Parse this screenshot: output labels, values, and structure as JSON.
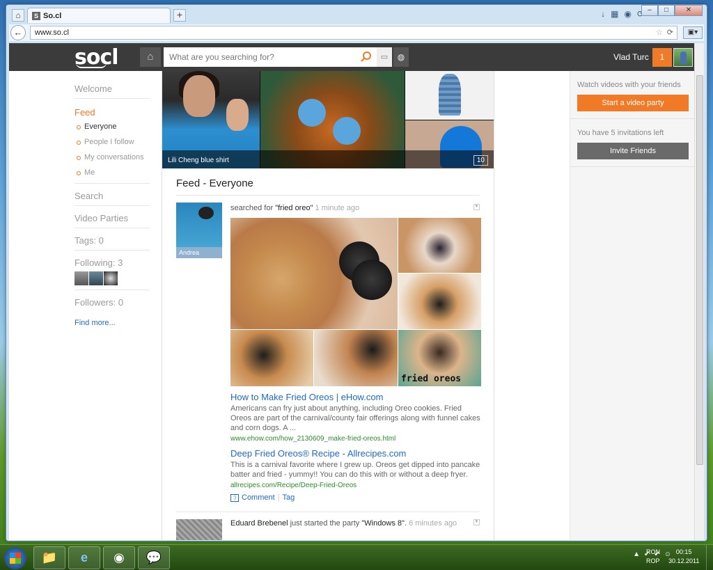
{
  "browser": {
    "tab_title": "So.cl",
    "tab_favicon": "S",
    "url": "www.so.cl",
    "home_tab_icon": "⌂",
    "new_tab_icon": "+",
    "back_icon": "←",
    "star_icon": "☆",
    "reload_icon": "⟳",
    "toolbar_icons": [
      "↓",
      "▦",
      "◉",
      "⟳"
    ],
    "win_min": "–",
    "win_max": "□",
    "win_close": "✕"
  },
  "header": {
    "logo": "socl",
    "home_icon": "⌂",
    "search_placeholder": "What are you searching for?",
    "chat_icon": "▭",
    "globe_icon": "◍",
    "user_name": "Vlad Turc",
    "notification_count": "1"
  },
  "leftnav": {
    "welcome": "Welcome",
    "feed": "Feed",
    "feed_items": [
      "Everyone",
      "People I follow",
      "My conversations",
      "Me"
    ],
    "search": "Search",
    "video_parties": "Video Parties",
    "tags": "Tags: 0",
    "following": "Following: 3",
    "followers": "Followers: 0",
    "find_more": "Find more..."
  },
  "banner": {
    "caption": "Lili Cheng blue shirt",
    "count": "10"
  },
  "feed": {
    "title": "Feed - Everyone",
    "post": {
      "poster": "Andrea",
      "action": "searched for ",
      "query": "\"fried oreo\"",
      "time": "1 minute ago",
      "image_label": "fried oreos",
      "results": [
        {
          "title": "How to Make Fried Oreos | eHow.com",
          "snippet": "Americans can fry just about anything, including Oreo cookies. Fried Oreos are part of the carnival/county fair offerings along with funnel cakes and corn dogs. A ...",
          "url": "www.ehow.com/how_2130609_make-fried-oreos.html"
        },
        {
          "title": "Deep Fried Oreos® Recipe - Allrecipes.com",
          "snippet": "This is a carnival favorite where I grew up. Oreos get dipped into pancake batter and fried - yummy!! You can do this with or without a deep fryer.",
          "url": "allrecipes.com/Recipe/Deep-Fried-Oreos"
        }
      ],
      "comment_label": "Comment",
      "tag_label": "Tag"
    },
    "post2": {
      "name": "Eduard Brebenel",
      "action": " just started the party ",
      "party": "\"Windows 8\"",
      "time": "6 minutes ago"
    }
  },
  "rightbar": {
    "watch_text": "Watch videos with your friends",
    "video_party_button": "Start a video party",
    "invites_text": "You have 5 invitations left",
    "invite_button": "Invite Friends"
  },
  "taskbar": {
    "apps": [
      "📁",
      "e",
      "◉",
      "💬"
    ],
    "lang_top": "RON",
    "lang_bottom": "ROP",
    "time": "00:15",
    "date": "30.12.2011"
  }
}
